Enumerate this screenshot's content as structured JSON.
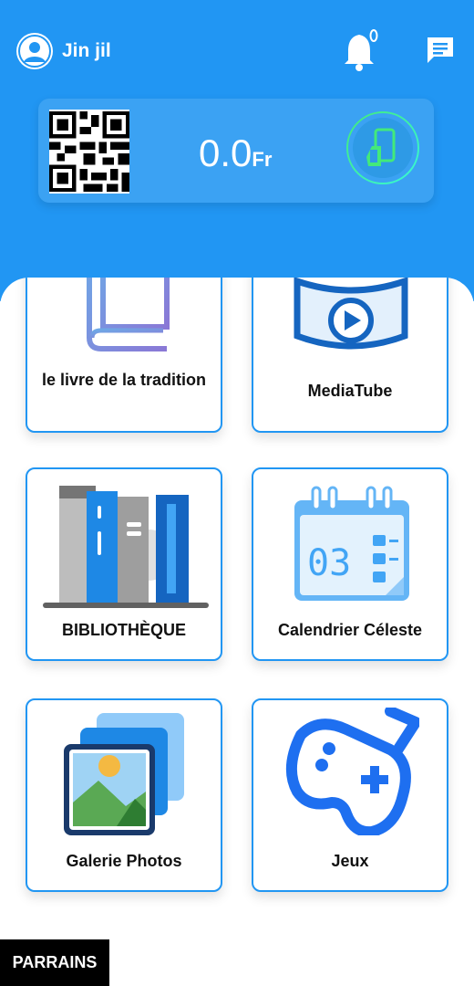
{
  "user": {
    "name": "Jin jil"
  },
  "wallet": {
    "amount": "0.0",
    "currency": "Fr"
  },
  "tiles": [
    {
      "label": "le livre de la tradition"
    },
    {
      "label": "MediaTube"
    },
    {
      "label": "BIBLIOTHÈQUE"
    },
    {
      "label": "Calendrier Céleste"
    },
    {
      "label": "Galerie Photos"
    },
    {
      "label": "Jeux"
    }
  ],
  "footer": {
    "parrains_label": "PARRAINS"
  },
  "icons": {
    "avatar": "user-avatar-icon",
    "notifications": "bell-icon",
    "messages": "chat-icon",
    "qr": "qr-code-icon",
    "scan": "phone-scan-icon"
  },
  "colors": {
    "primary": "#2196F3",
    "card": "#3ba2f3"
  }
}
